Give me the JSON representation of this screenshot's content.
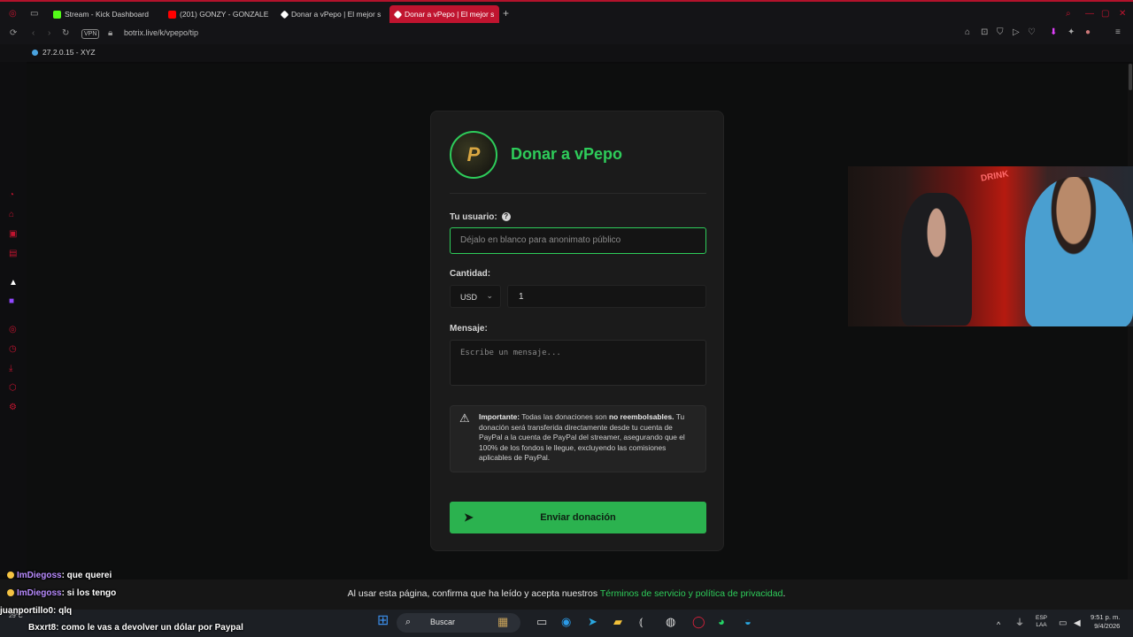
{
  "browser": {
    "tabs": [
      {
        "label": "Stream - Kick Dashboard",
        "color": "#53fc18"
      },
      {
        "label": "(201) GONZY - GONZALE",
        "color": "#ff0000"
      },
      {
        "label": "Donar a vPepo | El mejor s",
        "color": "#ffffff"
      },
      {
        "label": "Donar a vPepo | El mejor s",
        "color": "#ffffff"
      }
    ],
    "url": "botrix.live/k/vpepo/tip",
    "vpn_label": "VPN",
    "bookmark": "27.2.0.15 - XYZ"
  },
  "form": {
    "title": "Donar a vPepo",
    "logo_letter": "P",
    "username_label": "Tu usuario:",
    "username_placeholder": "Déjalo en blanco para anonimato público",
    "amount_label": "Cantidad:",
    "currency": "USD",
    "amount": "1",
    "message_label": "Mensaje:",
    "message_placeholder": "Escribe un mensaje...",
    "notice": {
      "important": "Importante:",
      "text1": "Todas las donaciones son",
      "bold": "no reembolsables.",
      "text2": "Tu donación será transferida directamente desde tu cuenta de PayPal a la cuenta de PayPal del streamer, asegurando que el 100% de los fondos le llegue, excluyendo las comisiones aplicables de PayPal."
    },
    "submit_label": "Enviar donación"
  },
  "footer": {
    "text": "Al usar esta página, confirma que ha leído y acepta nuestros",
    "link": "Términos de servicio y política de privacidad",
    "end": "."
  },
  "chat": [
    {
      "user": "ImDiegoss",
      "msg": ": que querei"
    },
    {
      "user": "ImDiegoss",
      "msg": ": si los tengo"
    },
    {
      "user": "juanportillo0",
      "msg": ": qlq"
    },
    {
      "user": "Bxxrt8",
      "msg": ": como le vas a devolver un dólar por Paypal"
    }
  ],
  "taskbar": {
    "search": "Buscar",
    "lang1": "ESP",
    "lang2": "LAA",
    "time": "9:51 p. m.",
    "date": "9/4/2026",
    "weather": "29°C"
  },
  "webcam": {
    "sign": "DRINK"
  },
  "colors": {
    "accent": "#2ecc5a",
    "browser": "#c0142f"
  }
}
